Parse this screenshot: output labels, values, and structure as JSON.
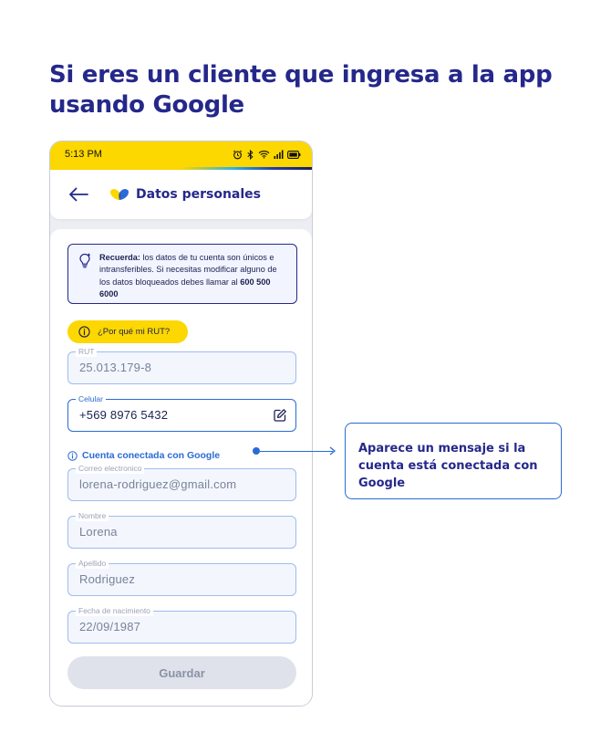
{
  "headline": "Si eres un cliente que ingresa a la app usando Google",
  "status_bar": {
    "time": "5:13 PM"
  },
  "app_bar": {
    "title": "Datos personales"
  },
  "notice": {
    "bold_prefix": "Recuerda:",
    "text": " los datos de tu cuenta son únicos e intransferibles. Si necesitas modificar alguno de los datos bloqueados debes llamar al ",
    "phone": "600 500 6000"
  },
  "why_rut": {
    "label": "¿Por qué mi RUT?"
  },
  "fields": {
    "rut": {
      "label": "RUT",
      "value": "25.013.179-8"
    },
    "celular": {
      "label": "Celular",
      "value": "+569 8976 5432"
    },
    "correo": {
      "label": "Correo electronico",
      "value": "lorena-rodriguez@gmail.com"
    },
    "nombre": {
      "label": "Nombre",
      "value": "Lorena"
    },
    "apellido": {
      "label": "Apellido",
      "value": "Rodriguez"
    },
    "fecha": {
      "label": "Fecha de nacimiento",
      "value": "22/09/1987"
    }
  },
  "google_message": "Cuenta conectada con Google",
  "save_button": "Guardar",
  "callout": "Aparece un mensaje si la cuenta está conectada con Google",
  "colors": {
    "primary": "#25288a",
    "accent_yellow": "#fcd700",
    "link_blue": "#2a6bd6",
    "disabled": "#dfe2ea"
  }
}
